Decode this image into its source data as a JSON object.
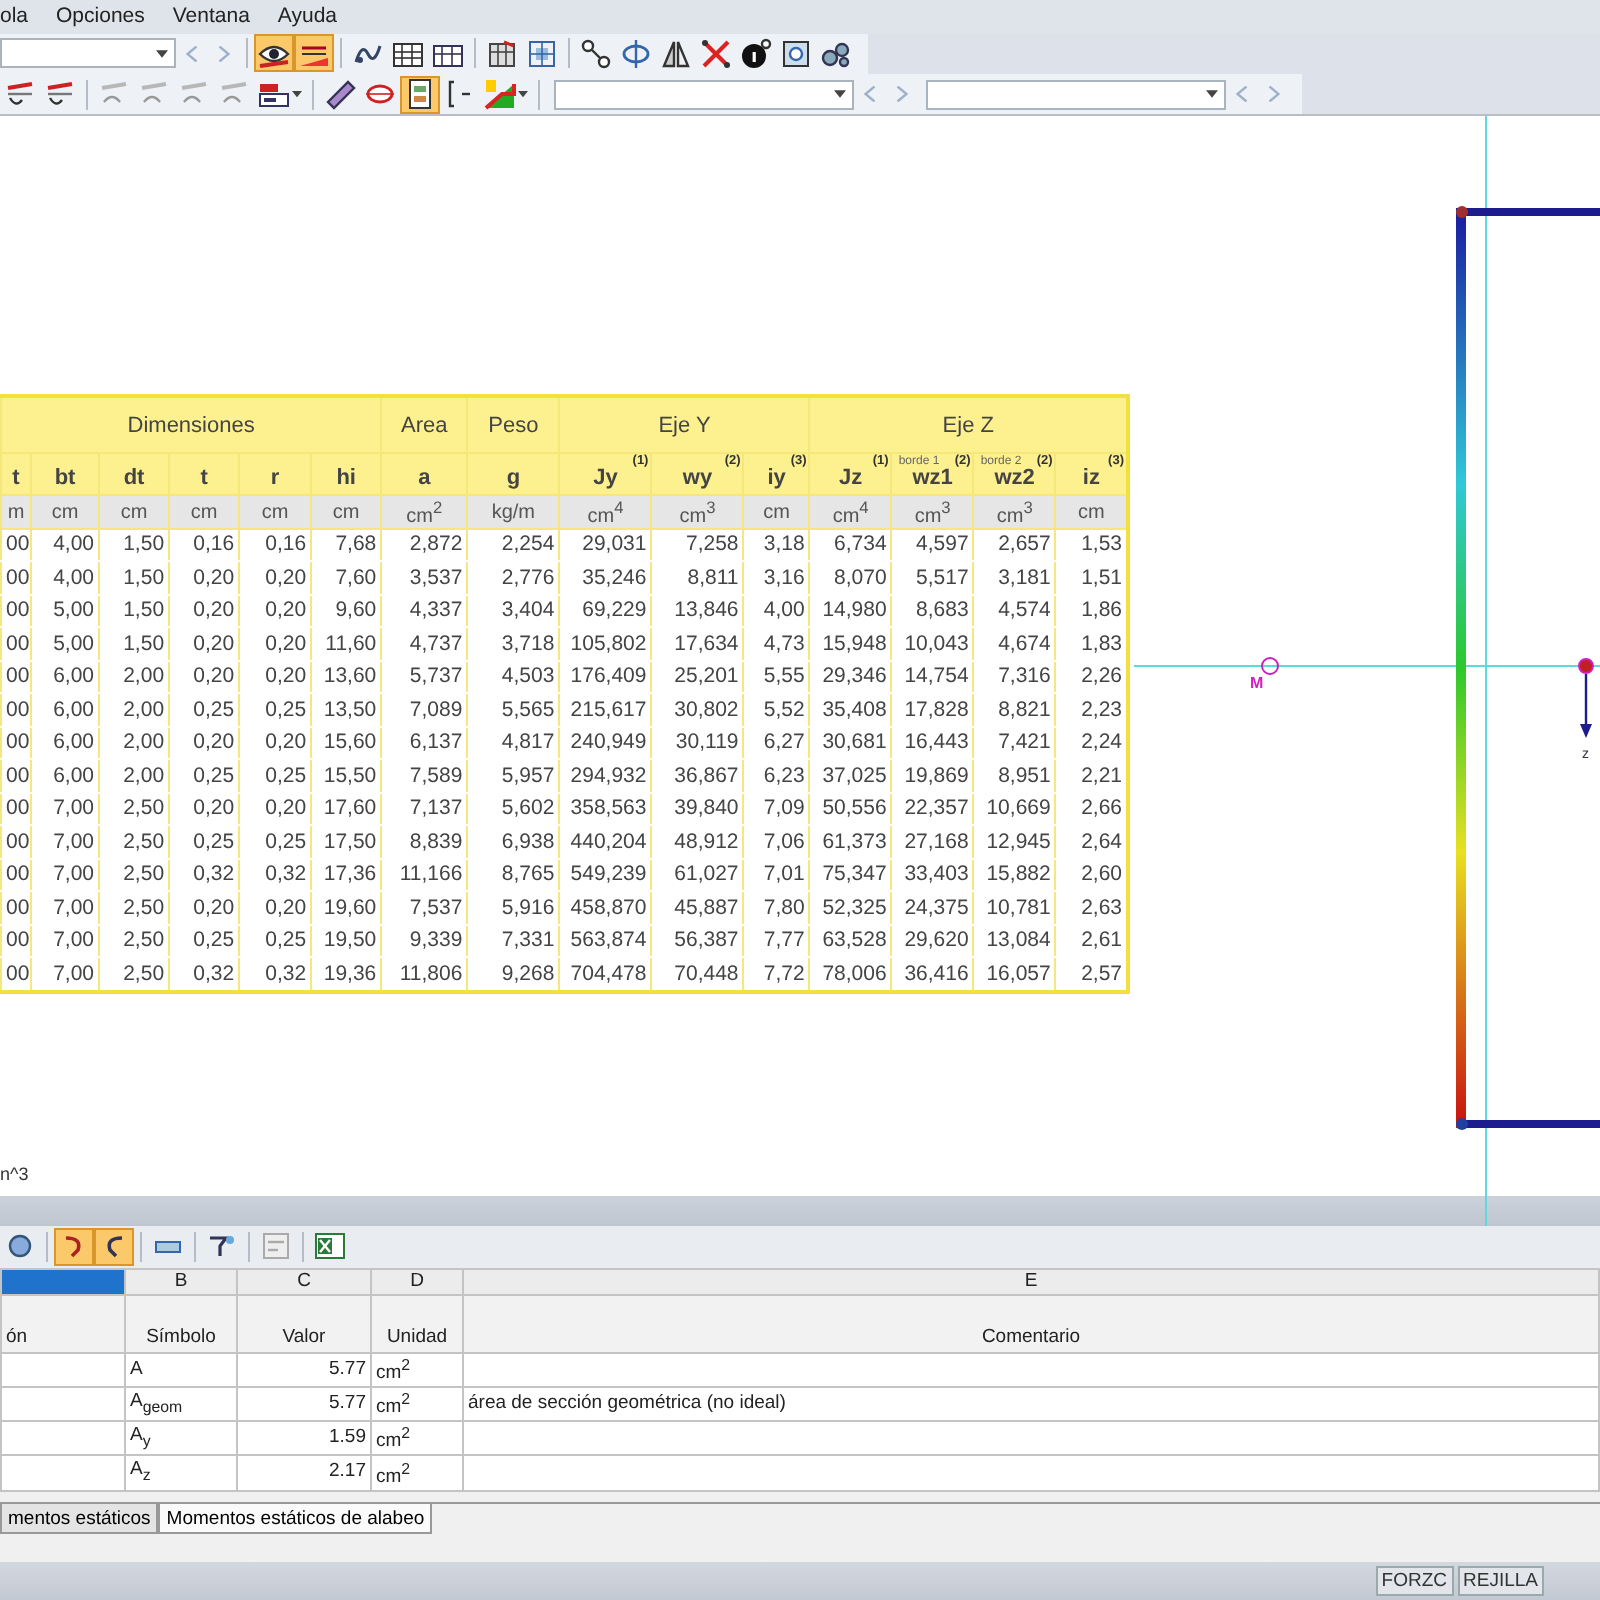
{
  "menu_bar": {
    "items": [
      "ola",
      "Opciones",
      "Ventana",
      "Ayuda"
    ]
  },
  "toolbar_top": {
    "navs": [
      {
        "disabled": true
      }
    ],
    "buttons": [
      {
        "active": true
      },
      {
        "active": true
      },
      {
        "active": false
      },
      {
        "active": false
      },
      {
        "active": false
      },
      {
        "active": false
      },
      {
        "active": false
      },
      {
        "active": false
      },
      {
        "active": false
      },
      {
        "active": false
      },
      {
        "active": false
      },
      {
        "active": false
      },
      {
        "active": false
      },
      {
        "active": false
      }
    ]
  },
  "toolbar_second": {
    "navs": [
      {
        "disabled": true
      },
      {
        "disabled": true
      }
    ],
    "buttons": [
      {
        "active": false
      },
      {
        "active": false
      },
      {
        "active": false
      },
      {
        "active": false
      },
      {
        "active": false
      },
      {
        "active": false
      },
      {
        "active": false
      },
      {
        "active": false
      },
      {
        "active": false
      },
      {
        "active": true
      },
      {
        "active": false
      },
      {
        "active": false
      }
    ]
  },
  "section_table": {
    "groups": [
      {
        "label": "Dimensiones",
        "columns": [
          {
            "symbol": "t",
            "unit": "m"
          },
          {
            "symbol": "bt",
            "unit": "cm"
          },
          {
            "symbol": "dt",
            "unit": "cm"
          },
          {
            "symbol": "t",
            "unit": "cm"
          },
          {
            "symbol": "r",
            "unit": "cm"
          },
          {
            "symbol": "hi",
            "unit": "cm"
          }
        ]
      },
      {
        "label": "Area",
        "columns": [
          {
            "symbol": "a",
            "unit": "cm$^{2}$"
          }
        ]
      },
      {
        "label": "Peso",
        "columns": [
          {
            "symbol": "g",
            "unit": "kg/m"
          }
        ]
      },
      {
        "label": "Eje Y",
        "columns": [
          {
            "symbol": "Jy",
            "note": "(1)",
            "unit": "cm$^{4}$"
          },
          {
            "symbol": "wy",
            "note": "(2)",
            "unit": "cm$^{3}$"
          },
          {
            "symbol": "iy",
            "note": "(3)",
            "unit": "cm"
          }
        ]
      },
      {
        "label": "Eje Z",
        "columns": [
          {
            "symbol": "Jz",
            "note": "(1)",
            "unit": "cm$^{4}$"
          },
          {
            "symbol": "wz1",
            "edge": "borde 1",
            "note": "(2)",
            "unit": "cm$^{3}$"
          },
          {
            "symbol": "wz2",
            "edge": "borde 2",
            "note": "(2)",
            "unit": "cm$^{3}$"
          },
          {
            "symbol": "iz",
            "note": "(3)",
            "unit": "cm"
          }
        ]
      }
    ],
    "row_groups": [
      [
        [
          "00",
          "4,00",
          "1,50",
          "0,16",
          "0,16",
          "7,68",
          "2,872",
          "2,254",
          "29,031",
          "7,258",
          "3,18",
          "6,734",
          "4,597",
          "2,657",
          "1,53"
        ],
        [
          "00",
          "4,00",
          "1,50",
          "0,20",
          "0,20",
          "7,60",
          "3,537",
          "2,776",
          "35,246",
          "8,811",
          "3,16",
          "8,070",
          "5,517",
          "3,181",
          "1,51"
        ]
      ],
      [
        [
          "00",
          "5,00",
          "1,50",
          "0,20",
          "0,20",
          "9,60",
          "4,337",
          "3,404",
          "69,229",
          "13,846",
          "4,00",
          "14,980",
          "8,683",
          "4,574",
          "1,86"
        ],
        [
          "00",
          "5,00",
          "1,50",
          "0,20",
          "0,20",
          "11,60",
          "4,737",
          "3,718",
          "105,802",
          "17,634",
          "4,73",
          "15,948",
          "10,043",
          "4,674",
          "1,83"
        ]
      ],
      [
        [
          "00",
          "6,00",
          "2,00",
          "0,20",
          "0,20",
          "13,60",
          "5,737",
          "4,503",
          "176,409",
          "25,201",
          "5,55",
          "29,346",
          "14,754",
          "7,316",
          "2,26"
        ],
        [
          "00",
          "6,00",
          "2,00",
          "0,25",
          "0,25",
          "13,50",
          "7,089",
          "5,565",
          "215,617",
          "30,802",
          "5,52",
          "35,408",
          "17,828",
          "8,821",
          "2,23"
        ]
      ],
      [
        [
          "00",
          "6,00",
          "2,00",
          "0,20",
          "0,20",
          "15,60",
          "6,137",
          "4,817",
          "240,949",
          "30,119",
          "6,27",
          "30,681",
          "16,443",
          "7,421",
          "2,24"
        ],
        [
          "00",
          "6,00",
          "2,00",
          "0,25",
          "0,25",
          "15,50",
          "7,589",
          "5,957",
          "294,932",
          "36,867",
          "6,23",
          "37,025",
          "19,869",
          "8,951",
          "2,21"
        ]
      ],
      [
        [
          "00",
          "7,00",
          "2,50",
          "0,20",
          "0,20",
          "17,60",
          "7,137",
          "5,602",
          "358,563",
          "39,840",
          "7,09",
          "50,556",
          "22,357",
          "10,669",
          "2,66"
        ],
        [
          "00",
          "7,00",
          "2,50",
          "0,25",
          "0,25",
          "17,50",
          "8,839",
          "6,938",
          "440,204",
          "48,912",
          "7,06",
          "61,373",
          "27,168",
          "12,945",
          "2,64"
        ],
        [
          "00",
          "7,00",
          "2,50",
          "0,32",
          "0,32",
          "17,36",
          "11,166",
          "8,765",
          "549,239",
          "61,027",
          "7,01",
          "75,347",
          "33,403",
          "15,882",
          "2,60"
        ]
      ],
      [
        [
          "00",
          "7,00",
          "2,50",
          "0,20",
          "0,20",
          "19,60",
          "7,537",
          "5,916",
          "458,870",
          "45,887",
          "7,80",
          "52,325",
          "24,375",
          "10,781",
          "2,63"
        ],
        [
          "00",
          "7,00",
          "2,50",
          "0,25",
          "0,25",
          "19,50",
          "9,339",
          "7,331",
          "563,874",
          "56,387",
          "7,77",
          "63,528",
          "29,620",
          "13,084",
          "2,61"
        ],
        [
          "00",
          "7,00",
          "2,50",
          "0,32",
          "0,32",
          "19,36",
          "11,806",
          "9,268",
          "704,478",
          "70,448",
          "7,72",
          "78,006",
          "36,416",
          "16,057",
          "2,57"
        ]
      ]
    ]
  },
  "section_view": {
    "shear_center_label": "M",
    "axis_label": "z"
  },
  "unit_note": "n^3",
  "panel_toolbar": {
    "buttons": [
      {
        "active": false
      },
      {
        "active": true
      },
      {
        "active": true
      },
      {
        "active": false
      },
      {
        "active": false
      },
      {
        "active": false
      },
      {
        "active": false
      }
    ]
  },
  "results_grid": {
    "columns": [
      {
        "selected": true
      },
      {
        "letter": "B",
        "selected": false
      },
      {
        "letter": "C",
        "selected": false
      },
      {
        "letter": "D",
        "selected": false
      },
      {
        "letter": "E",
        "selected": false
      }
    ],
    "headers": [
      "ón",
      "Símbolo",
      "Valor",
      "Unidad",
      "Comentario"
    ],
    "rows": [
      {
        "symbol": "A",
        "value": "5.77",
        "unit": "cm$^{2}$"
      },
      {
        "symbol": "A$_{geom}$",
        "value": "5.77",
        "unit": "cm$^{2}$",
        "comment": "área de sección geométrica (no ideal)"
      },
      {
        "symbol": "A$_{y}$",
        "value": "1.59",
        "unit": "cm$^{2}$"
      },
      {
        "symbol": "A$_{z}$",
        "value": "2.17",
        "unit": "cm$^{2}$"
      }
    ]
  },
  "sheet_tabs": [
    {
      "label": "mentos estáticos",
      "selected": false
    },
    {
      "label": "Momentos estáticos de alabeo",
      "selected": true
    }
  ],
  "status_bar": {
    "indicators": [
      "FORZC",
      "REJILLA"
    ]
  }
}
